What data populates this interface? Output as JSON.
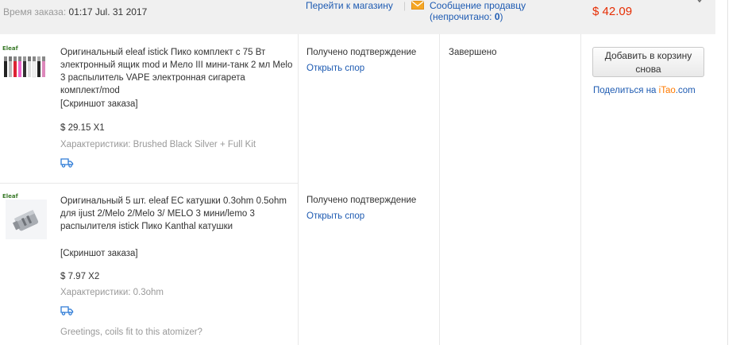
{
  "header": {
    "order_time_label": "Время заказа:",
    "order_time_value": "01:17 Jul. 31 2017",
    "store_link": "Перейти к магазину",
    "separator": "|",
    "message_link_line1": "Сообщение продавцу",
    "message_link_line2_prefix": "(непрочитано: ",
    "message_unread_count": "0",
    "message_link_line2_suffix": ")",
    "total": "$ 42.09"
  },
  "items": [
    {
      "thumb_brand": "Eleaf",
      "title": "Оригинальный eleaf istick Пико комплект с 75 Вт электронный ящик mod и Мело III мини-танк 2 мл Melo 3 распылитель VAPE электронная сигарета комплект/mod",
      "snapshot": "[Скриншот заказа]",
      "price": "$ 29.15 X1",
      "props": "Характеристики: Brushed Black Silver + Full Kit",
      "status": "Получено подтверждение",
      "dispute": "Открыть спор"
    },
    {
      "thumb_brand": "Eleaf",
      "title": "Оригинальный 5 шт. eleaf EC катушки 0.3ohm 0.5ohm для ijust 2/Melo 2/Melo 3/ MELO 3 мини/lemo 3 распылителя istick Пико Kanthal катушки",
      "snapshot": "[Скриншот заказа]",
      "price": "$ 7.97 X2",
      "props": "Характеристики: 0.3ohm",
      "status": "Получено подтверждение",
      "dispute": "Открыть спор",
      "buyer_note": "Greetings, coils fit to this atomizer?"
    }
  ],
  "order_status": "Завершено",
  "actions": {
    "add_to_cart": "Добавить в корзину снова",
    "share_prefix": "Поделиться на ",
    "share_site": "iTao",
    "share_suffix": ".com"
  },
  "icons": {
    "message": "envelope-icon",
    "shipping": "truck-icon"
  },
  "colors": {
    "link": "#1e5bb2",
    "price_total": "#e62e04",
    "envelope": "#f5a623",
    "itao": "#ff7a00"
  }
}
